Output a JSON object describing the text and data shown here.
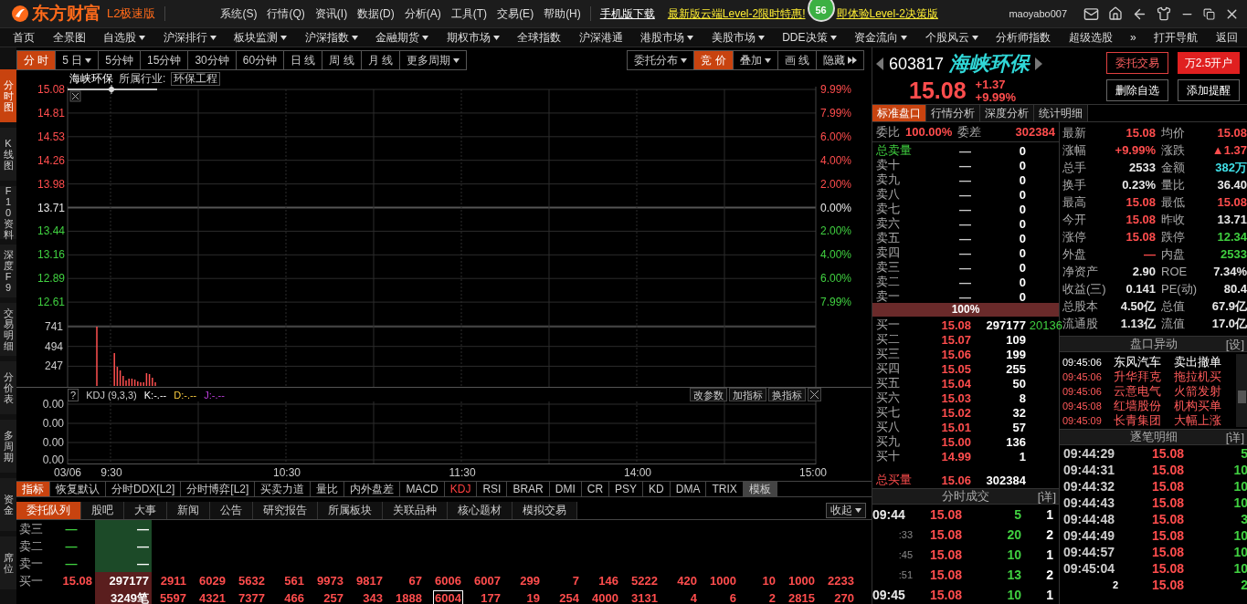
{
  "title_bar": {
    "logo": "东方财富",
    "edition": "L2极速版",
    "menus": [
      "系统(S)",
      "行情(Q)",
      "资讯(I)",
      "数据(D)",
      "分析(A)",
      "工具(T)",
      "交易(E)",
      "帮助(H)"
    ],
    "link": "手机版下载",
    "promo_left": "最新版云端Level-2限时特惠!",
    "badge": "56",
    "promo_right": "即体验Level-2决策版",
    "user": "maoyabo007"
  },
  "nav": [
    {
      "label": "首页",
      "kind": "plain"
    },
    {
      "label": "全景图",
      "kind": "plain"
    },
    {
      "label": "自选股",
      "kind": "dropdown"
    },
    {
      "label": "沪深排行",
      "kind": "dropdown"
    },
    {
      "label": "板块监测",
      "kind": "dropdown"
    },
    {
      "label": "沪深指数",
      "kind": "dropdown"
    },
    {
      "label": "金融期货",
      "kind": "dropdown"
    },
    {
      "label": "期权市场",
      "kind": "dropdown"
    },
    {
      "label": "全球指数",
      "kind": "plain"
    },
    {
      "label": "沪深港通",
      "kind": "plain"
    },
    {
      "label": "港股市场",
      "kind": "dropdown"
    },
    {
      "label": "美股市场",
      "kind": "dropdown"
    },
    {
      "label": "DDE决策",
      "kind": "dropdown"
    },
    {
      "label": "资金流向",
      "kind": "dropdown"
    },
    {
      "label": "个股风云",
      "kind": "dropdown"
    },
    {
      "label": "分析师指数",
      "kind": "plain"
    },
    {
      "label": "超级选股",
      "kind": "plain"
    },
    {
      "label": "»",
      "kind": "plain"
    },
    {
      "label": "打开导航",
      "kind": "plain"
    },
    {
      "label": "返回",
      "kind": "plain"
    }
  ],
  "side_tabs": [
    {
      "label": "分时图",
      "selected": true
    },
    {
      "label": "K线图",
      "selected": false
    },
    {
      "label": "F10资料",
      "selected": false
    },
    {
      "label": "深度F9",
      "selected": false
    },
    {
      "label": "交易明细",
      "selected": false
    },
    {
      "label": "分价表",
      "selected": false
    },
    {
      "label": "多周期",
      "selected": false
    },
    {
      "label": "资金",
      "selected": false
    },
    {
      "label": "席位",
      "selected": false
    }
  ],
  "period_tabs": [
    {
      "label": "分 时",
      "kind": "plain",
      "selected": true
    },
    {
      "label": "5 日",
      "kind": "dropdown",
      "selected": false
    },
    {
      "label": "5分钟",
      "kind": "plain",
      "selected": false
    },
    {
      "label": "15分钟",
      "kind": "plain",
      "selected": false
    },
    {
      "label": "30分钟",
      "kind": "plain",
      "selected": false
    },
    {
      "label": "60分钟",
      "kind": "plain",
      "selected": false
    },
    {
      "label": "日 线",
      "kind": "plain",
      "selected": false
    },
    {
      "label": "周 线",
      "kind": "plain",
      "selected": false
    },
    {
      "label": "月 线",
      "kind": "plain",
      "selected": false
    },
    {
      "label": "更多周期",
      "kind": "dropdown",
      "selected": false
    }
  ],
  "chart_tools": [
    {
      "label": "委托分布",
      "kind": "dropdown",
      "selected": false
    },
    {
      "label": "竞 价",
      "kind": "plain",
      "selected": true
    },
    {
      "label": "叠加",
      "kind": "dropdown",
      "selected": false
    },
    {
      "label": "画 线",
      "kind": "plain",
      "selected": false
    },
    {
      "label": "隐藏",
      "kind": "more",
      "selected": false
    }
  ],
  "legend": {
    "name": "海峡环保",
    "industry_label": "所属行业:",
    "industry": "环保工程"
  },
  "price_chart": {
    "left_labels": [
      "15.08",
      "14.81",
      "14.53",
      "14.26",
      "13.98",
      "13.71",
      "13.44",
      "13.16",
      "12.89",
      "12.61"
    ],
    "right_labels": [
      "9.99%",
      "7.99%",
      "6.00%",
      "4.00%",
      "2.00%",
      "0.00%",
      "2.00%",
      "4.00%",
      "6.00%",
      "7.99%"
    ]
  },
  "volume_chart": {
    "kind": "picture",
    "axis_labels": [
      "741",
      "494",
      "247"
    ]
  },
  "time_axis": [
    "03/06",
    "9:30",
    "10:30",
    "11:30",
    "14:00",
    "15:00"
  ],
  "kdj": {
    "help": "?",
    "name": "KDJ (9,3,3)",
    "k": "K:-.--",
    "d": "D:-.--",
    "j": "J:-.--",
    "buttons": [
      "改参数",
      "加指标",
      "换指标"
    ],
    "yticks": [
      "0.00",
      "0.00",
      "0.00",
      "0.00"
    ]
  },
  "indicator_tabs": [
    {
      "label": "指标",
      "kind": "label",
      "selected": false
    },
    {
      "label": "恢复默认",
      "kind": "tab",
      "selected": false
    },
    {
      "label": "分时DDX[L2]",
      "kind": "tab",
      "selected": false
    },
    {
      "label": "分时博弈[L2]",
      "kind": "tab",
      "selected": false
    },
    {
      "label": "买卖力道",
      "kind": "tab",
      "selected": false
    },
    {
      "label": "量比",
      "kind": "tab",
      "selected": false
    },
    {
      "label": "内外盘差",
      "kind": "tab",
      "selected": false
    },
    {
      "label": "MACD",
      "kind": "tab",
      "selected": false
    },
    {
      "label": "KDJ",
      "kind": "tab",
      "selected": true
    },
    {
      "label": "RSI",
      "kind": "tab",
      "selected": false
    },
    {
      "label": "BRAR",
      "kind": "tab",
      "selected": false
    },
    {
      "label": "DMI",
      "kind": "tab",
      "selected": false
    },
    {
      "label": "CR",
      "kind": "tab",
      "selected": false
    },
    {
      "label": "PSY",
      "kind": "tab",
      "selected": false
    },
    {
      "label": "KD",
      "kind": "tab",
      "selected": false
    },
    {
      "label": "DMA",
      "kind": "tab",
      "selected": false
    },
    {
      "label": "TRIX",
      "kind": "tab",
      "selected": false
    },
    {
      "label": "模板",
      "kind": "template",
      "selected": false
    }
  ],
  "info_tabs": [
    {
      "label": "委托队列",
      "selected": true
    },
    {
      "label": "股吧",
      "selected": false
    },
    {
      "label": "大事",
      "selected": false
    },
    {
      "label": "新闻",
      "selected": false
    },
    {
      "label": "公告",
      "selected": false
    },
    {
      "label": "研究报告",
      "selected": false
    },
    {
      "label": "所属板块",
      "selected": false
    },
    {
      "label": "关联品种",
      "selected": false
    },
    {
      "label": "核心题材",
      "selected": false
    },
    {
      "label": "模拟交易",
      "selected": false
    }
  ],
  "collapse": "收起",
  "queue": [
    {
      "label": "卖三",
      "kind": "ask",
      "price": "—",
      "total": "—"
    },
    {
      "label": "卖二",
      "kind": "ask",
      "price": "—",
      "total": "—"
    },
    {
      "label": "卖一",
      "kind": "ask",
      "price": "—",
      "total": "—"
    },
    {
      "label": "买一",
      "kind": "bid",
      "price": "15.08",
      "total": "297177",
      "orders": [
        {
          "text": "2911",
          "selected": false
        },
        {
          "text": "6029",
          "selected": false
        },
        {
          "text": "5632",
          "selected": false
        },
        {
          "text": "561",
          "selected": false
        },
        {
          "text": "9973",
          "selected": false
        },
        {
          "text": "9817",
          "selected": false
        },
        {
          "text": "67",
          "selected": false
        },
        {
          "text": "6006",
          "selected": false
        },
        {
          "text": "6007",
          "selected": false
        },
        {
          "text": "299",
          "selected": false
        },
        {
          "text": "7",
          "selected": false
        },
        {
          "text": "146",
          "selected": false
        },
        {
          "text": "5222",
          "selected": false
        },
        {
          "text": "420",
          "selected": false
        },
        {
          "text": "1000",
          "selected": false
        },
        {
          "text": "10",
          "selected": false
        },
        {
          "text": "1000",
          "selected": false
        },
        {
          "text": "2233",
          "selected": false
        }
      ]
    },
    {
      "kind": "bid",
      "total": "3249笔",
      "orders": [
        {
          "text": "5597",
          "selected": false
        },
        {
          "text": "4321",
          "selected": false
        },
        {
          "text": "7377",
          "selected": false
        },
        {
          "text": "466",
          "selected": false
        },
        {
          "text": "257",
          "selected": false
        },
        {
          "text": "343",
          "selected": false
        },
        {
          "text": "1888",
          "selected": false
        },
        {
          "text": "6004",
          "selected": true
        },
        {
          "text": "177",
          "selected": false
        },
        {
          "text": "19",
          "selected": false
        },
        {
          "text": "254",
          "selected": false
        },
        {
          "text": "4000",
          "selected": false
        },
        {
          "text": "3131",
          "selected": false
        },
        {
          "text": "4",
          "selected": false
        },
        {
          "text": "6",
          "selected": false
        },
        {
          "text": "2",
          "selected": false
        },
        {
          "text": "2815",
          "selected": false
        },
        {
          "text": "270",
          "selected": false
        }
      ]
    }
  ],
  "quote": {
    "code": "603817",
    "name": "海峡环保",
    "price": "15.08",
    "change": "+1.37",
    "change_pct": "+9.99%",
    "buttons": [
      {
        "label": "委托交易",
        "kind": "outline"
      },
      {
        "label": "万2.5开户",
        "kind": "primary"
      },
      {
        "label": "删除自选",
        "kind": "plain"
      },
      {
        "label": "添加提醒",
        "kind": "plain"
      }
    ]
  },
  "detail_tabs": [
    {
      "label": "标准盘口",
      "selected": true
    },
    {
      "label": "行情分析",
      "selected": false
    },
    {
      "label": "深度分析",
      "selected": false
    },
    {
      "label": "统计明细",
      "selected": false
    }
  ],
  "order_book": {
    "ratio_label": "委比",
    "ratio": "100.00%",
    "diff_label": "委差",
    "diff": "302384",
    "sell_total": {
      "label": "总卖量",
      "price": "—",
      "volume": "0"
    },
    "asks": [
      {
        "label": "卖十",
        "price": "—",
        "volume": "0"
      },
      {
        "label": "卖九",
        "price": "—",
        "volume": "0"
      },
      {
        "label": "卖八",
        "price": "—",
        "volume": "0"
      },
      {
        "label": "卖七",
        "price": "—",
        "volume": "0"
      },
      {
        "label": "卖六",
        "price": "—",
        "volume": "0"
      },
      {
        "label": "卖五",
        "price": "—",
        "volume": "0"
      },
      {
        "label": "卖四",
        "price": "—",
        "volume": "0"
      },
      {
        "label": "卖三",
        "price": "—",
        "volume": "0"
      },
      {
        "label": "卖二",
        "price": "—",
        "volume": "0"
      },
      {
        "label": "卖一",
        "price": "—",
        "volume": "0"
      }
    ],
    "bar": {
      "label": "100%",
      "level": 1
    },
    "bids": [
      {
        "label": "买一",
        "price": "15.08",
        "volume": "297177",
        "extra": "20136"
      },
      {
        "label": "买二",
        "price": "15.07",
        "volume": "109"
      },
      {
        "label": "买三",
        "price": "15.06",
        "volume": "199"
      },
      {
        "label": "买四",
        "price": "15.05",
        "volume": "255"
      },
      {
        "label": "买五",
        "price": "15.04",
        "volume": "50"
      },
      {
        "label": "买六",
        "price": "15.03",
        "volume": "8"
      },
      {
        "label": "买七",
        "price": "15.02",
        "volume": "32"
      },
      {
        "label": "买八",
        "price": "15.01",
        "volume": "57"
      },
      {
        "label": "买九",
        "price": "15.00",
        "volume": "136"
      },
      {
        "label": "买十",
        "price": "14.99",
        "volume": "1"
      }
    ],
    "buy_total": {
      "label": "总买量",
      "price": "15.06",
      "volume": "302384"
    }
  },
  "minute_trades": {
    "title": "分时成交",
    "more": "[详]",
    "rows": [
      {
        "time": "09:44",
        "price": "15.08",
        "volume": "5",
        "count": "1",
        "kind": "minute"
      },
      {
        "time": ":33",
        "price": "15.08",
        "volume": "20",
        "count": "2",
        "kind": "second"
      },
      {
        "time": ":45",
        "price": "15.08",
        "volume": "10",
        "count": "1",
        "kind": "second"
      },
      {
        "time": ":51",
        "price": "15.08",
        "volume": "13",
        "count": "2",
        "kind": "second"
      },
      {
        "time": "09:45",
        "price": "15.08",
        "volume": "10",
        "count": "1",
        "kind": "minute"
      }
    ]
  },
  "stats": [
    [
      {
        "label": "最新",
        "value": "15.08",
        "color": "#ff4d4d"
      },
      {
        "label": "均价",
        "value": "15.08",
        "color": "#ff4d4d"
      }
    ],
    [
      {
        "label": "涨幅",
        "value": "+9.99%",
        "color": "#ff4d4d"
      },
      {
        "label": "涨跌",
        "value": "▲1.37",
        "color": "#ff4d4d"
      }
    ],
    [
      {
        "label": "总手",
        "value": "2533",
        "color": "#e8e8e8"
      },
      {
        "label": "金额",
        "value": "382万",
        "color": "#40e0e8"
      }
    ],
    [
      {
        "label": "换手",
        "value": "0.23%",
        "color": "#e8e8e8"
      },
      {
        "label": "量比",
        "value": "36.40",
        "color": "#e8e8e8"
      }
    ],
    [
      {
        "label": "最高",
        "value": "15.08",
        "color": "#ff4d4d"
      },
      {
        "label": "最低",
        "value": "15.08",
        "color": "#ff4d4d"
      }
    ],
    [
      {
        "label": "今开",
        "value": "15.08",
        "color": "#ff4d4d"
      },
      {
        "label": "昨收",
        "value": "13.71",
        "color": "#e8e8e8"
      }
    ],
    [
      {
        "label": "涨停",
        "value": "15.08",
        "color": "#ff4d4d"
      },
      {
        "label": "跌停",
        "value": "12.34",
        "color": "#40d040"
      }
    ],
    [
      {
        "label": "外盘",
        "value": "—",
        "color": "#ff4d4d"
      },
      {
        "label": "内盘",
        "value": "2533",
        "color": "#40d040"
      }
    ],
    [
      {
        "label": "净资产",
        "value": "2.90",
        "color": "#e8e8e8"
      },
      {
        "label": "ROE",
        "value": "7.34%",
        "color": "#e8e8e8"
      }
    ],
    [
      {
        "label": "收益(三)",
        "value": "0.141",
        "color": "#e8e8e8"
      },
      {
        "label": "PE(动)",
        "value": "80.4",
        "color": "#e8e8e8"
      }
    ],
    [
      {
        "label": "总股本",
        "value": "4.50亿",
        "color": "#e8e8e8"
      },
      {
        "label": "总值",
        "value": "67.9亿",
        "color": "#e8e8e8"
      }
    ],
    [
      {
        "label": "流通股",
        "value": "1.13亿",
        "color": "#e8e8e8"
      },
      {
        "label": "流值",
        "value": "17.0亿",
        "color": "#e8e8e8"
      }
    ]
  ],
  "alerts": {
    "title": "盘口异动",
    "more": "[设]",
    "rows": [
      {
        "time": "09:45:06",
        "stock": "东风汽车",
        "event": "卖出撤单",
        "color": "#ffffff"
      },
      {
        "time": "09:45:06",
        "stock": "升华拜克",
        "event": "拖拉机买",
        "color": "#ff5a5a"
      },
      {
        "time": "09:45:06",
        "stock": "云意电气",
        "event": "火箭发射",
        "color": "#ff5a5a"
      },
      {
        "time": "09:45:08",
        "stock": "红墙股份",
        "event": "机构买单",
        "color": "#ff5a5a"
      },
      {
        "time": "09:45:09",
        "stock": "长青集团",
        "event": "大幅上涨",
        "color": "#ff5a5a"
      }
    ]
  },
  "ticks": {
    "title": "逐笔明细",
    "more": "[详]",
    "rows": [
      {
        "time": "09:44:29",
        "price": "15.08",
        "volume": "5",
        "kind": "full"
      },
      {
        "time": "09:44:31",
        "price": "15.08",
        "volume": "10",
        "kind": "full"
      },
      {
        "time": "09:44:32",
        "price": "15.08",
        "volume": "10",
        "kind": "full"
      },
      {
        "time": "09:44:43",
        "price": "15.08",
        "volume": "10",
        "kind": "full"
      },
      {
        "time": "09:44:48",
        "price": "15.08",
        "volume": "3",
        "kind": "full"
      },
      {
        "time": "09:44:49",
        "price": "15.08",
        "volume": "10",
        "kind": "full"
      },
      {
        "time": "09:44:57",
        "price": "15.08",
        "volume": "10",
        "kind": "full"
      },
      {
        "time": "09:45:04",
        "price": "15.08",
        "volume": "10",
        "kind": "full"
      },
      {
        "time": "2",
        "price": "15.08",
        "volume": "2",
        "kind": "short"
      }
    ]
  }
}
